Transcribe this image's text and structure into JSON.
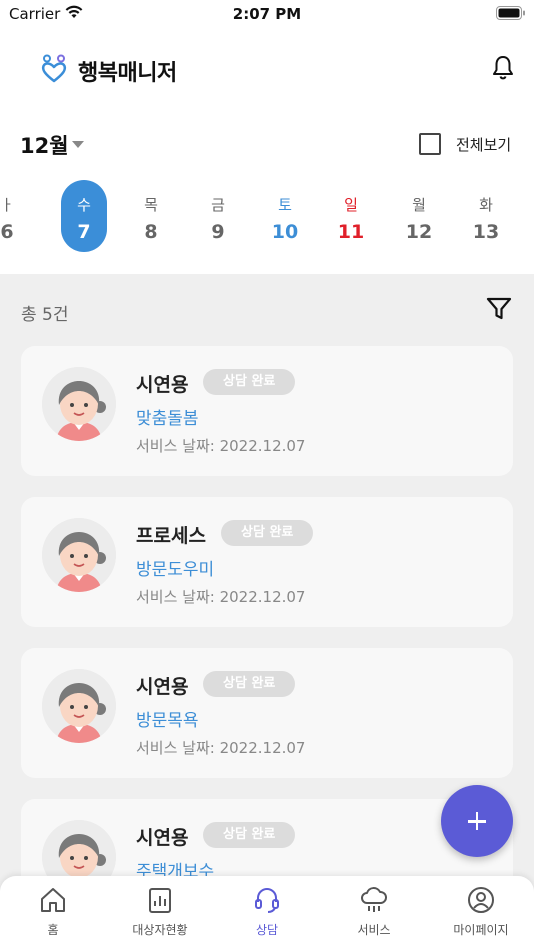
{
  "status_bar": {
    "carrier": "Carrier",
    "time": "2:07 PM"
  },
  "header": {
    "title": "행복매니저"
  },
  "month": {
    "label": "12월",
    "view_all_label": "전체보기"
  },
  "week_days": [
    {
      "dow": "ㅏ",
      "num": "6",
      "type": "weekday"
    },
    {
      "dow": "수",
      "num": "7",
      "type": "selected"
    },
    {
      "dow": "목",
      "num": "8",
      "type": "weekday"
    },
    {
      "dow": "금",
      "num": "9",
      "type": "weekday"
    },
    {
      "dow": "토",
      "num": "10",
      "type": "saturday"
    },
    {
      "dow": "일",
      "num": "11",
      "type": "sunday"
    },
    {
      "dow": "월",
      "num": "12",
      "type": "weekday"
    },
    {
      "dow": "화",
      "num": "13",
      "type": "weekday"
    }
  ],
  "list": {
    "total": "총 5건",
    "cards": [
      {
        "name": "시연용",
        "badge": "상담 완료",
        "service": "맞춤돌봄",
        "date": "서비스 날짜: 2022.12.07"
      },
      {
        "name": "프로세스",
        "badge": "상담 완료",
        "service": "방문도우미",
        "date": "서비스 날짜: 2022.12.07"
      },
      {
        "name": "시연용",
        "badge": "상담 완료",
        "service": "방문목욕",
        "date": "서비스 날짜: 2022.12.07"
      },
      {
        "name": "시연용",
        "badge": "상담 완료",
        "service": "주택개보수",
        "date": ""
      }
    ]
  },
  "tabs": [
    {
      "label": "홈",
      "icon": "home-icon"
    },
    {
      "label": "대상자현황",
      "icon": "report-icon"
    },
    {
      "label": "상담",
      "icon": "headset-icon",
      "active": true
    },
    {
      "label": "서비스",
      "icon": "cloud-icon"
    },
    {
      "label": "마이페이지",
      "icon": "user-circle-icon"
    }
  ],
  "colors": {
    "accent_blue": "#3b8ed8",
    "fab_purple": "#5b5bd6",
    "sunday_red": "#e0202a",
    "badge_gray": "#dcdcdc"
  }
}
